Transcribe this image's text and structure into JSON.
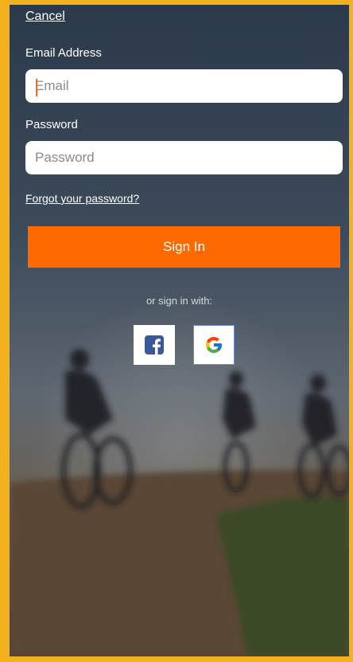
{
  "header": {
    "cancel_label": "Cancel"
  },
  "form": {
    "email_label": "Email Address",
    "email_placeholder": "Email",
    "email_value": "",
    "password_label": "Password",
    "password_placeholder": "Password",
    "password_value": "",
    "forgot_label": "Forgot your password?",
    "signin_label": "Sign In"
  },
  "social": {
    "divider_text": "or sign in with:",
    "providers": [
      "facebook-icon",
      "google-icon"
    ]
  },
  "colors": {
    "accent": "#ff6a00",
    "facebook": "#3b5998",
    "frame": "#f3b21d"
  }
}
